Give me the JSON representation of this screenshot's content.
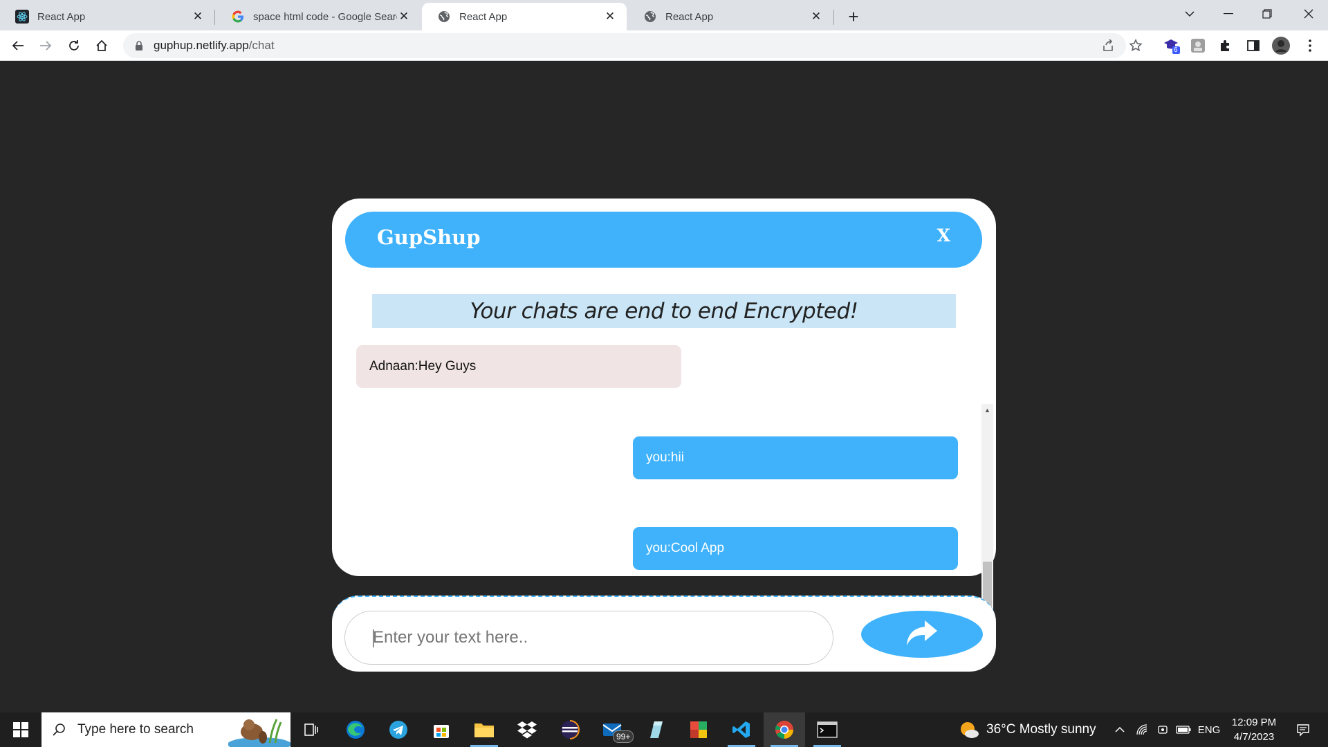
{
  "browser": {
    "tabs": [
      {
        "title": "React App",
        "icon": "react-icon"
      },
      {
        "title": "space html code - Google Search",
        "icon": "google-icon"
      },
      {
        "title": "React App",
        "icon": "globe-icon",
        "active": true
      },
      {
        "title": "React App",
        "icon": "globe-icon"
      }
    ],
    "url_host": "guphup.netlify.app",
    "url_path": "/chat",
    "extension_badge": "6"
  },
  "chat": {
    "brand": "GupShup",
    "close_label": "X",
    "encryption_notice": "Your chats are end to end Encrypted!",
    "messages": [
      {
        "side": "incoming",
        "text": "Adnaan:Hey Guys"
      },
      {
        "side": "outgoing",
        "text": "you:hii"
      },
      {
        "side": "outgoing",
        "text": "you:Cool App"
      }
    ],
    "input_placeholder": "Enter your text here..",
    "send_icon": "share-arrow-icon"
  },
  "colors": {
    "accent": "#3fb2fb",
    "banner": "#c9e5f6",
    "incoming_bubble": "#f1e4e4",
    "page_bg": "#262626"
  },
  "taskbar": {
    "search_placeholder": "Type here to search",
    "mail_badge": "99+",
    "weather_text": "36°C  Mostly sunny",
    "lang": "ENG",
    "time": "12:09 PM",
    "date": "4/7/2023"
  }
}
